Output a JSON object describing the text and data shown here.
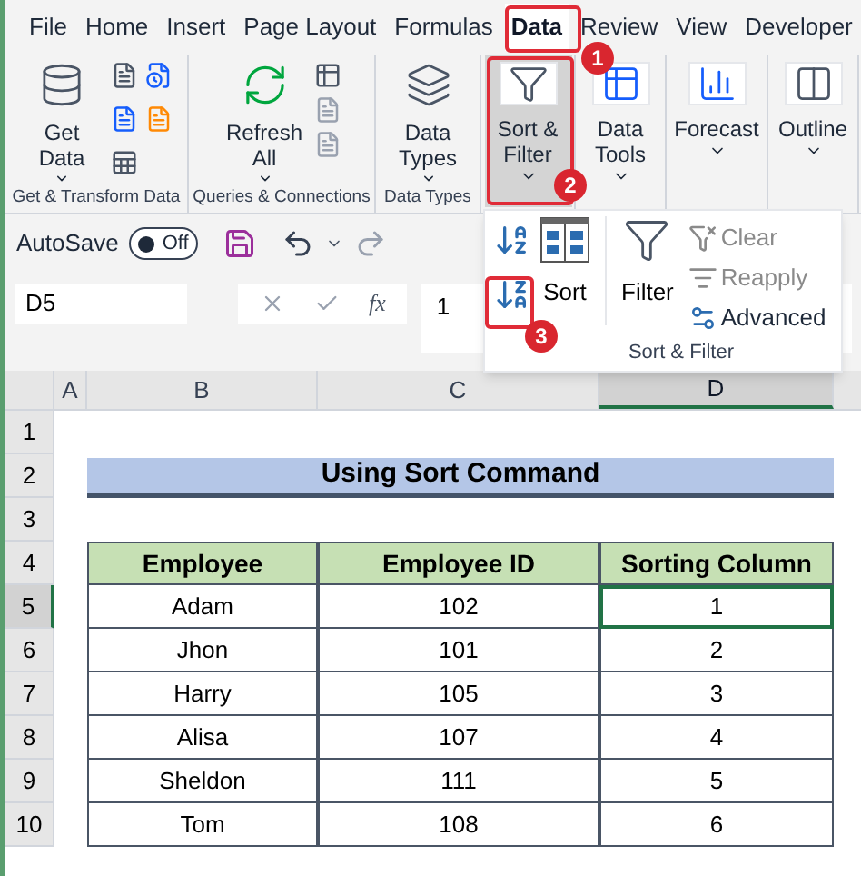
{
  "tabs": [
    {
      "label": "File",
      "selected": false
    },
    {
      "label": "Home",
      "selected": false
    },
    {
      "label": "Insert",
      "selected": false
    },
    {
      "label": "Page Layout",
      "selected": false
    },
    {
      "label": "Formulas",
      "selected": false
    },
    {
      "label": "Data",
      "selected": true
    },
    {
      "label": "Review",
      "selected": false
    },
    {
      "label": "View",
      "selected": false
    },
    {
      "label": "Developer",
      "selected": false
    }
  ],
  "ribbon_groups": [
    {
      "label": "Get & Transform Data",
      "button": {
        "kind": "get-data",
        "label": "Get Data",
        "selected": false
      }
    },
    {
      "label": "Queries & Connections",
      "button": {
        "kind": "refresh",
        "label": "Refresh All",
        "selected": false
      }
    },
    {
      "label": "Data Types",
      "button": {
        "kind": "data-types",
        "label": "Data Types",
        "selected": false
      }
    },
    {
      "button": {
        "kind": "sort-filter",
        "label": "Sort & Filter",
        "selected": true
      }
    },
    {
      "button": {
        "kind": "data-tools",
        "label": "Data Tools",
        "selected": false
      }
    },
    {
      "button": {
        "kind": "forecast",
        "label": "Forecast",
        "selected": false
      }
    },
    {
      "button": {
        "kind": "outline",
        "label": "Outline",
        "selected": false
      }
    }
  ],
  "quick_access": {
    "autosave_label": "AutoSave",
    "autosave_toggle": {
      "label": "Off",
      "on": false
    }
  },
  "formula_bar": {
    "name_box": "D5",
    "function_label": "fx",
    "value": "1"
  },
  "sort_menu": {
    "sort_button": "Sort",
    "filter_button": "Filter",
    "small_buttons": [
      {
        "kind": "clear",
        "label": "Clear",
        "disabled": true
      },
      {
        "kind": "reapply",
        "label": "Reapply",
        "disabled": true
      },
      {
        "kind": "advanced",
        "label": "Advanced",
        "disabled": false
      }
    ],
    "group_label": "Sort & Filter"
  },
  "sheet": {
    "columns": [
      {
        "label": "A",
        "selected": false
      },
      {
        "label": "B",
        "selected": false
      },
      {
        "label": "C",
        "selected": false
      },
      {
        "label": "D",
        "selected": true
      }
    ],
    "rows": [
      {
        "label": "1",
        "selected": false
      },
      {
        "label": "2",
        "selected": false
      },
      {
        "label": "3",
        "selected": false
      },
      {
        "label": "4",
        "selected": false
      },
      {
        "label": "5",
        "selected": true
      },
      {
        "label": "6",
        "selected": false
      },
      {
        "label": "7",
        "selected": false
      },
      {
        "label": "8",
        "selected": false
      },
      {
        "label": "9",
        "selected": false
      },
      {
        "label": "10",
        "selected": false
      }
    ]
  },
  "table": {
    "title": "Using Sort Command",
    "headers": [
      "Employee",
      "Employee ID",
      "Sorting Column"
    ],
    "rows": [
      [
        "Adam",
        "102",
        "1"
      ],
      [
        "Jhon",
        "101",
        "2"
      ],
      [
        "Harry",
        "105",
        "3"
      ],
      [
        "Alisa",
        "107",
        "4"
      ],
      [
        "Sheldon",
        "111",
        "5"
      ],
      [
        "Tom",
        "108",
        "6"
      ]
    ]
  },
  "callouts": [
    "1",
    "2",
    "3"
  ]
}
